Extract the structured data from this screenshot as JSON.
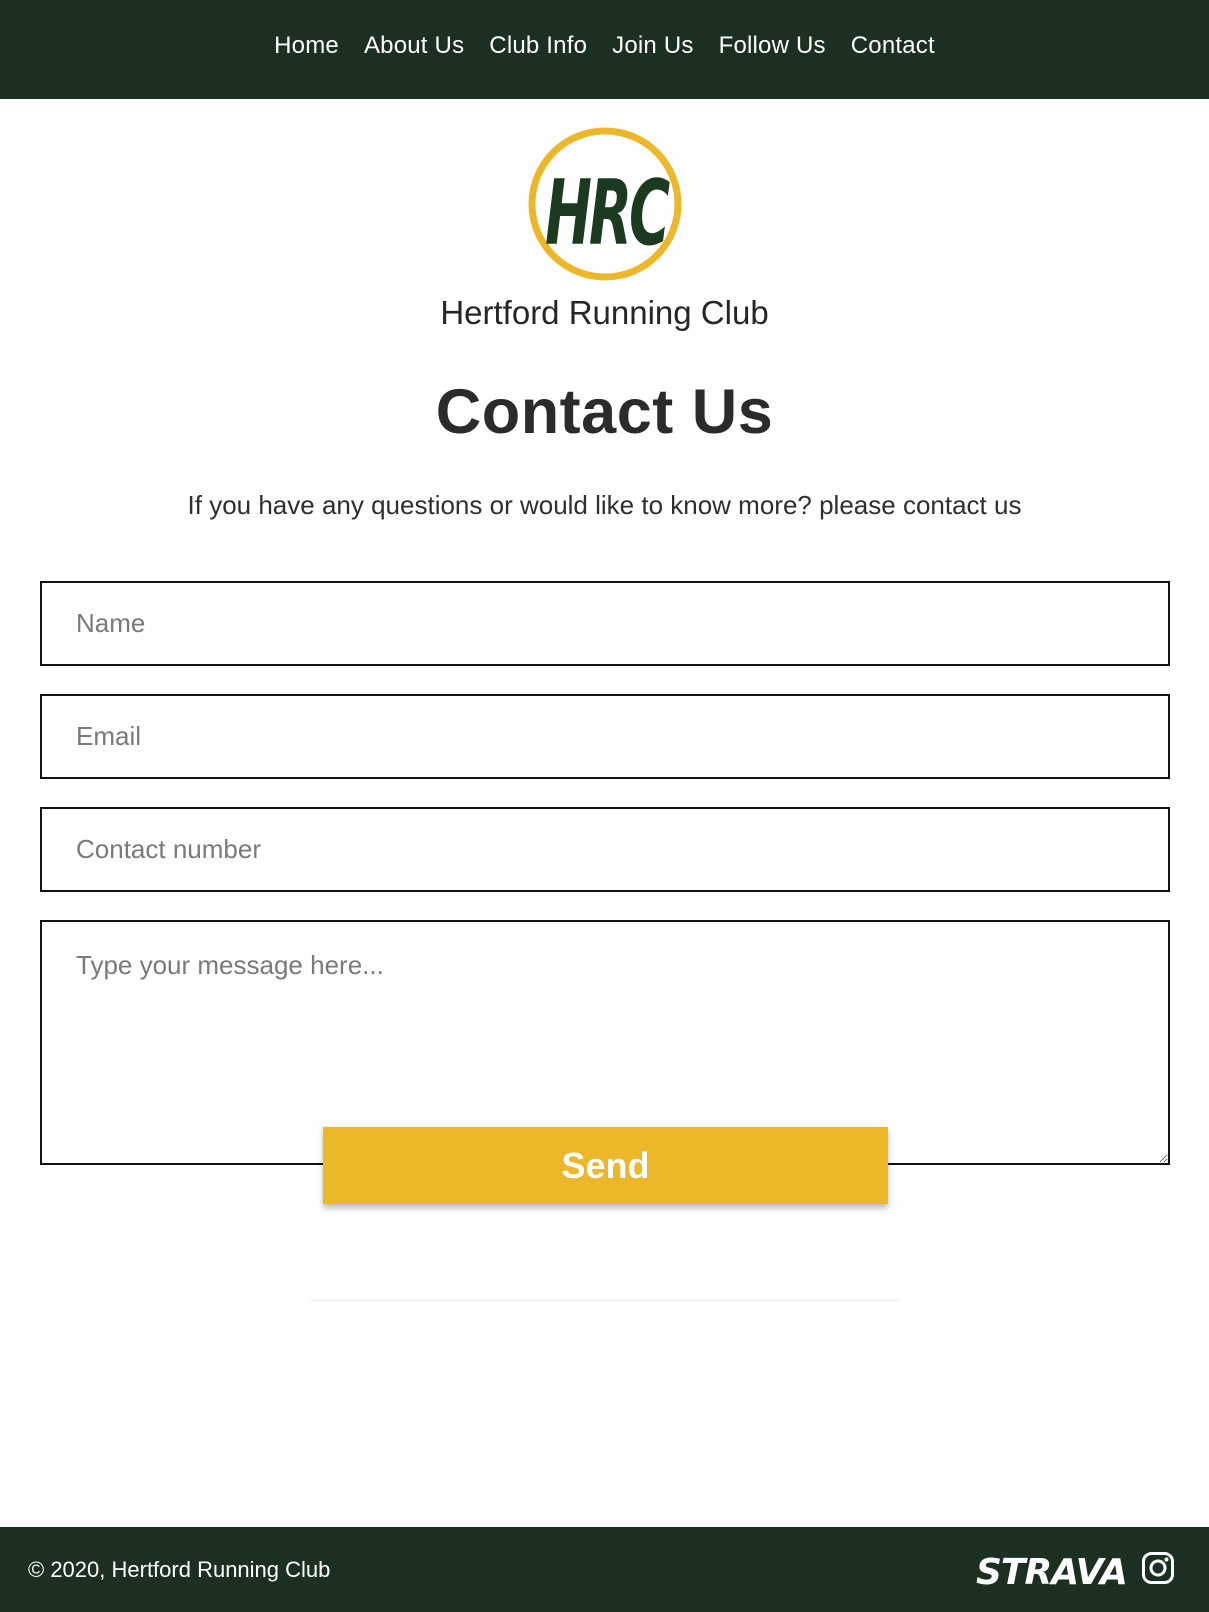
{
  "nav": {
    "items": [
      {
        "label": "Home"
      },
      {
        "label": "About Us"
      },
      {
        "label": "Club Info"
      },
      {
        "label": "Join Us"
      },
      {
        "label": "Follow Us"
      },
      {
        "label": "Contact"
      }
    ]
  },
  "brand": {
    "logo_text": "HRC",
    "club_name": "Hertford Running Club",
    "colors": {
      "dark_green": "#1b3020",
      "gold": "#ecb729"
    }
  },
  "page": {
    "title": "Contact Us",
    "intro": "If you have any questions or would like to know more? please contact us"
  },
  "form": {
    "name_placeholder": "Name",
    "email_placeholder": "Email",
    "phone_placeholder": "Contact number",
    "message_placeholder": "Type your message here...",
    "send_label": "Send"
  },
  "footer": {
    "copyright": "© 2020, Hertford Running Club",
    "strava_label": "STRAVA",
    "icons": [
      "strava-logo",
      "instagram-icon"
    ]
  }
}
